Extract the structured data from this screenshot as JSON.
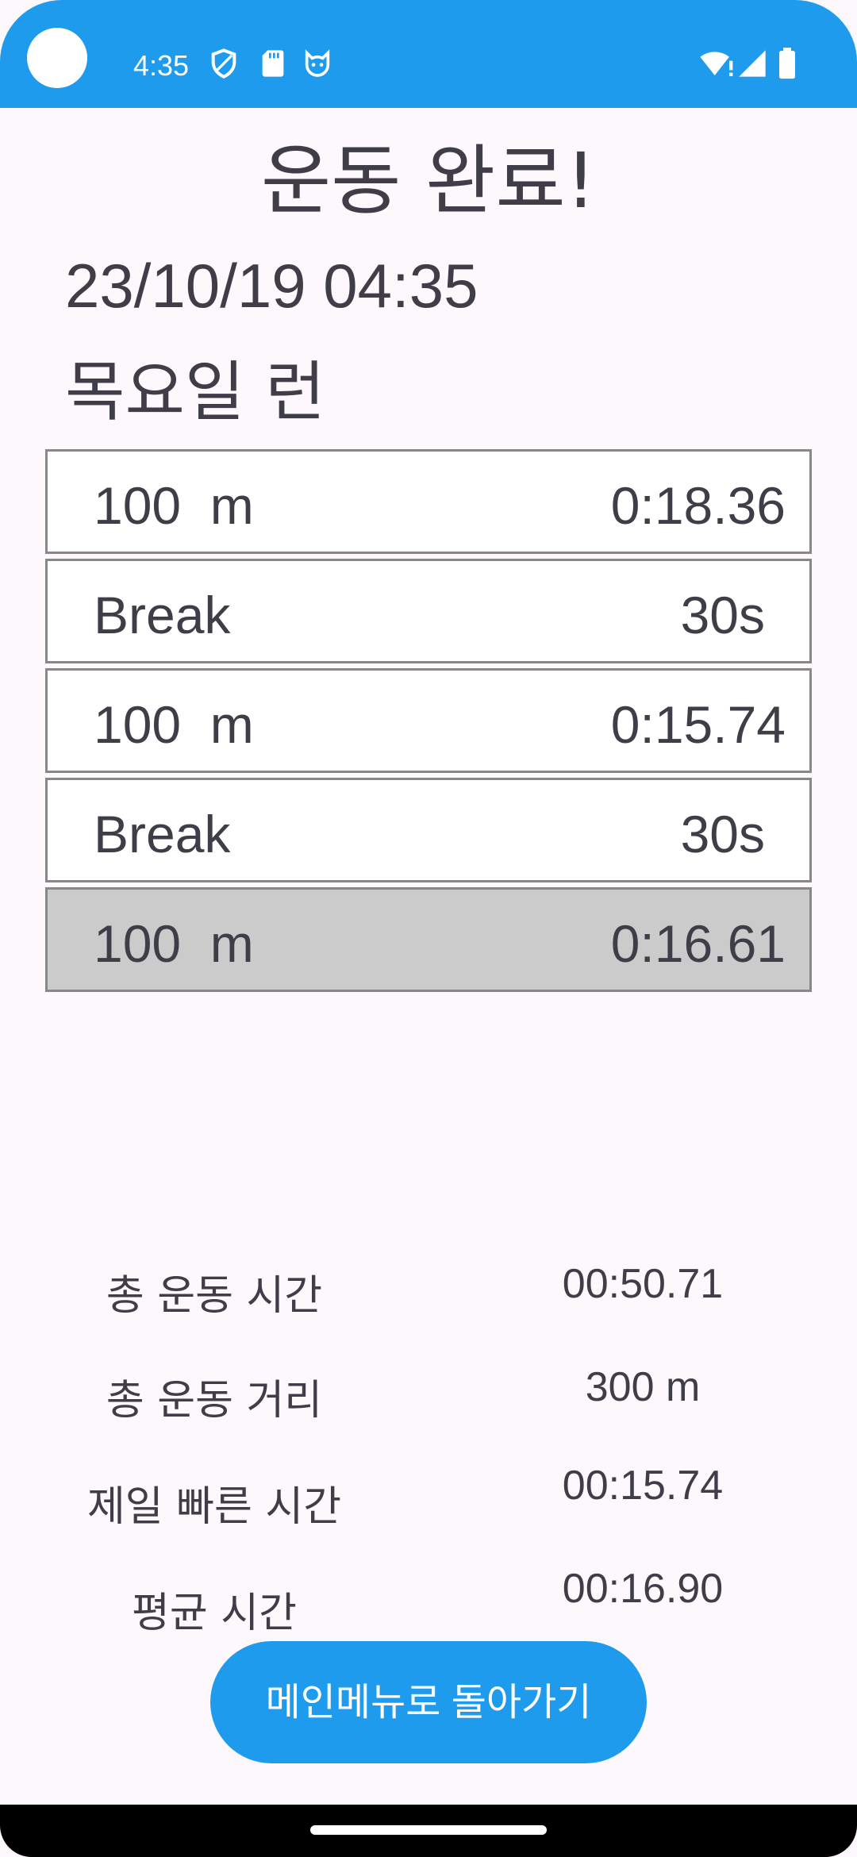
{
  "status_bar": {
    "time": "4:35",
    "icons": [
      "shield-icon",
      "sd-card-icon",
      "cat-face-icon",
      "wifi-alert-icon",
      "cell-signal-icon",
      "battery-icon"
    ]
  },
  "title": "운동 완료!",
  "datetime": "23/10/19 04:35",
  "workout_name": "목요일 런",
  "intervals": [
    {
      "label": "100  m",
      "value": "0:18.36",
      "type": "run",
      "highlighted": false
    },
    {
      "label": "Break",
      "value": "30s",
      "type": "break",
      "highlighted": false
    },
    {
      "label": "100  m",
      "value": "0:15.74",
      "type": "run",
      "highlighted": false
    },
    {
      "label": "Break",
      "value": "30s",
      "type": "break",
      "highlighted": false
    },
    {
      "label": "100  m",
      "value": "0:16.61",
      "type": "run",
      "highlighted": true
    }
  ],
  "stats": [
    {
      "label": "총 운동 시간",
      "value": "00:50.71"
    },
    {
      "label": "총 운동 거리",
      "value": "300 m"
    },
    {
      "label": "제일 빠른 시간",
      "value": "00:15.74"
    },
    {
      "label": "평균 시간",
      "value": "00:16.90"
    }
  ],
  "main_menu_button": "메인메뉴로 돌아가기",
  "colors": {
    "accent": "#1e9bec",
    "highlight_row": "#cbcbcb",
    "text": "#3f3d47",
    "background": "#fcf8fc"
  }
}
